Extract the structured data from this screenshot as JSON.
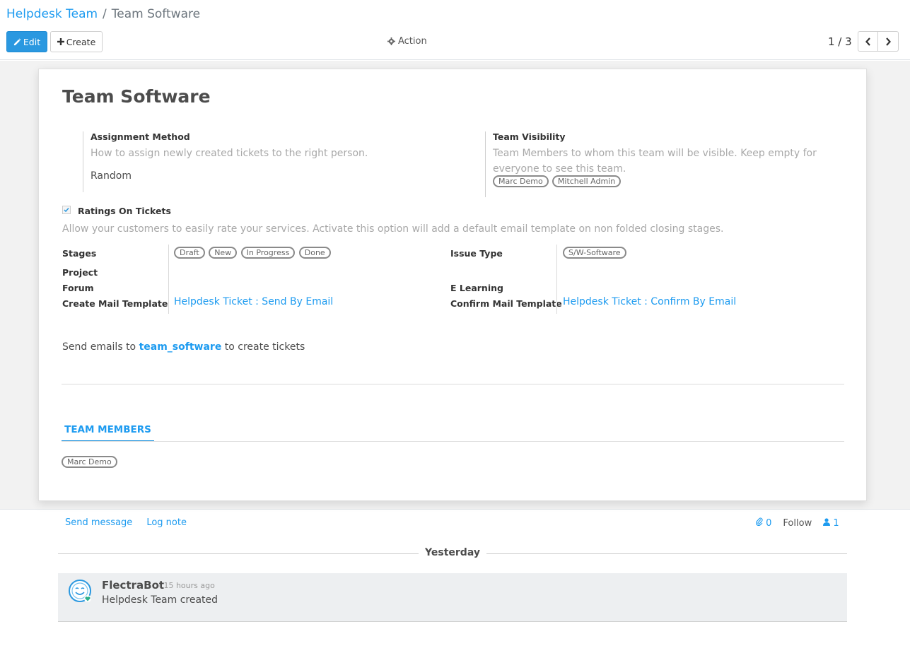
{
  "breadcrumb": {
    "parent": "Helpdesk Team",
    "separator": "/",
    "current": "Team Software"
  },
  "toolbar": {
    "edit_label": "Edit",
    "create_label": "Create",
    "action_label": "Action"
  },
  "pager": {
    "value": "1 / 3"
  },
  "record": {
    "title": "Team Software",
    "assignment": {
      "label": "Assignment Method",
      "help": "How to assign newly created tickets to the right person.",
      "value": "Random"
    },
    "visibility": {
      "label": "Team Visibility",
      "help_line1": "Team Members to whom this team will be visible. Keep empty for",
      "help_line2": "everyone to see this team.",
      "tags": [
        "Marc Demo",
        "Mitchell Admin"
      ]
    },
    "ratings": {
      "label": "Ratings On Tickets",
      "checked": true,
      "help": "Allow your customers to easily rate your services. Activate this option will add a default email template on non folded closing stages."
    },
    "stages": {
      "label": "Stages",
      "tags": [
        "Draft",
        "New",
        "In Progress",
        "Done"
      ]
    },
    "issue_type": {
      "label": "Issue Type",
      "tags": [
        "S/W-Software"
      ]
    },
    "project": {
      "label": "Project"
    },
    "forum": {
      "label": "Forum"
    },
    "elearning": {
      "label": "E Learning"
    },
    "create_template": {
      "label": "Create Mail Template",
      "value": "Helpdesk Ticket : Send By Email"
    },
    "confirm_template": {
      "label": "Confirm Mail Template",
      "value": "Helpdesk Ticket : Confirm By Email"
    },
    "alias": {
      "prefix": "Send emails to",
      "name": "team_software",
      "suffix": "to create tickets"
    },
    "tabs": {
      "members_label": "TEAM MEMBERS"
    },
    "members": [
      "Marc Demo"
    ]
  },
  "chatter": {
    "send_message": "Send message",
    "log_note": "Log note",
    "attachments_count": "0",
    "follow_label": "Follow",
    "followers_count": "1",
    "date_separator": "Yesterday",
    "messages": [
      {
        "author": "FlectraBot",
        "time": "- 15 hours ago",
        "body": "Helpdesk Team created"
      }
    ]
  },
  "colors": {
    "primary": "#2a98e0",
    "link": "#1d9bf0",
    "muted": "#a8a8a8"
  }
}
